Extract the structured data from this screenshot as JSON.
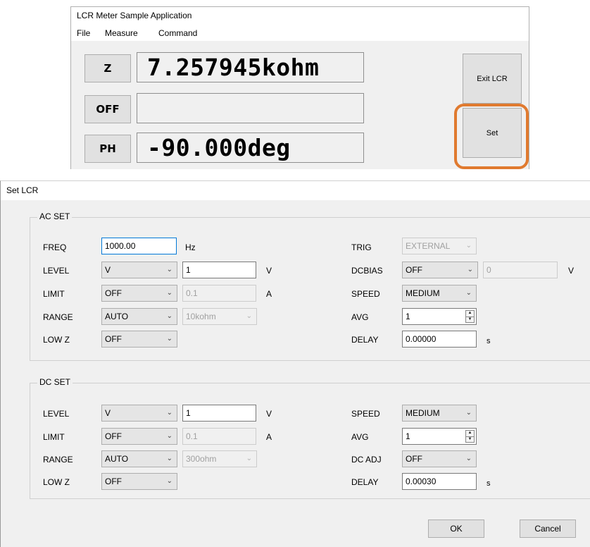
{
  "main": {
    "title": "LCR Meter Sample Application",
    "menu": [
      "File",
      "Measure",
      "Command"
    ],
    "rows": [
      {
        "button": "Z",
        "value": "7.257945kohm"
      },
      {
        "button": "OFF",
        "value": ""
      },
      {
        "button": "PH",
        "value": "-90.000deg"
      }
    ],
    "exit_label": "Exit LCR",
    "set_label": "Set",
    "highlight_color": "#e07a2f"
  },
  "dialog": {
    "title": "Set LCR",
    "ac": {
      "title": "AC SET",
      "freq_label": "FREQ",
      "freq_value": "1000.00",
      "freq_unit": "Hz",
      "level_label": "LEVEL",
      "level_mode": "V",
      "level_value": "1",
      "level_unit": "V",
      "limit_label": "LIMIT",
      "limit_mode": "OFF",
      "limit_value": "0.1",
      "limit_unit": "A",
      "range_label": "RANGE",
      "range_mode": "AUTO",
      "range_value": "10kohm",
      "lowz_label": "LOW Z",
      "lowz_value": "OFF",
      "trig_label": "TRIG",
      "trig_value": "EXTERNAL",
      "dcbias_label": "DCBIAS",
      "dcbias_mode": "OFF",
      "dcbias_value": "0",
      "dcbias_unit": "V",
      "speed_label": "SPEED",
      "speed_value": "MEDIUM",
      "avg_label": "AVG",
      "avg_value": "1",
      "delay_label": "DELAY",
      "delay_value": "0.00000",
      "delay_unit": "s"
    },
    "dc": {
      "title": "DC SET",
      "level_label": "LEVEL",
      "level_mode": "V",
      "level_value": "1",
      "level_unit": "V",
      "limit_label": "LIMIT",
      "limit_mode": "OFF",
      "limit_value": "0.1",
      "limit_unit": "A",
      "range_label": "RANGE",
      "range_mode": "AUTO",
      "range_value": "300ohm",
      "lowz_label": "LOW Z",
      "lowz_value": "OFF",
      "speed_label": "SPEED",
      "speed_value": "MEDIUM",
      "avg_label": "AVG",
      "avg_value": "1",
      "dcadj_label": "DC ADJ",
      "dcadj_value": "OFF",
      "delay_label": "DELAY",
      "delay_value": "0.00030",
      "delay_unit": "s"
    },
    "ok_label": "OK",
    "cancel_label": "Cancel"
  }
}
